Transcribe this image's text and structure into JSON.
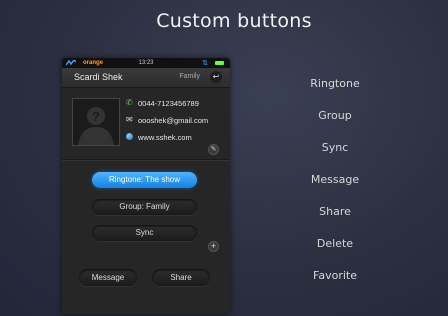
{
  "page": {
    "title": "Custom buttons"
  },
  "labels": [
    "Ringtone",
    "Group",
    "Sync",
    "Message",
    "Share",
    "Delete",
    "Favorite"
  ],
  "phone": {
    "status_bar": {
      "carrier": "orange",
      "time": "13:23"
    },
    "header": {
      "name": "Scardi Shek",
      "group": "Family",
      "back_icon": "back-arrow-icon"
    },
    "contact": {
      "phone": "0044-7123456789",
      "email": "oooshek@gmail.com",
      "website": "www.sshek.com"
    },
    "buttons": {
      "ringtone": "Ringtone: The show",
      "group": "Group: Family",
      "sync": "Sync",
      "message": "Message",
      "share": "Share"
    },
    "colors": {
      "accent": "#2a95f5",
      "carrier": "#ff9a3c",
      "battery": "#6cff3a",
      "phone_icon": "#5fcf5a"
    }
  }
}
